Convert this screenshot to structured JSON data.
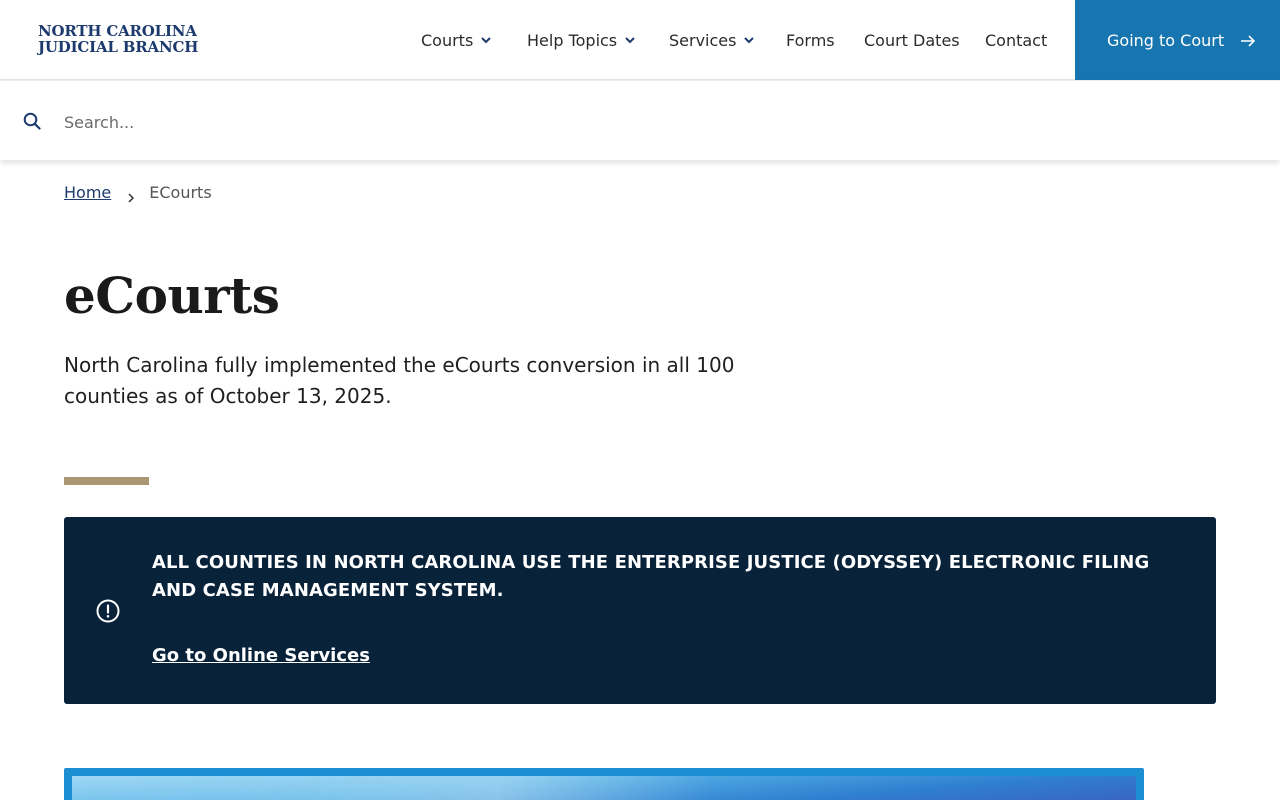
{
  "header": {
    "logo_line1": "NORTH CAROLINA",
    "logo_line2": "JUDICIAL BRANCH",
    "nav": [
      {
        "label": "Courts",
        "has_dropdown": true
      },
      {
        "label": "Help Topics",
        "has_dropdown": true
      },
      {
        "label": "Services",
        "has_dropdown": true
      },
      {
        "label": "Forms",
        "has_dropdown": false
      },
      {
        "label": "Court Dates",
        "has_dropdown": false
      },
      {
        "label": "Contact",
        "has_dropdown": false
      }
    ],
    "cta_label": "Going to Court"
  },
  "search": {
    "placeholder": "Search...",
    "icon": "search-icon"
  },
  "breadcrumb": {
    "home": "Home",
    "current": "ECourts"
  },
  "main": {
    "title": "eCourts",
    "intro": "North Carolina fully implemented the eCourts conversion in all 100 counties as of October 13, 2025.",
    "alert": {
      "icon": "exclamation-circle-icon",
      "text": "All counties in North Carolina use the Enterprise Justice (Odyssey) electronic filing and case management system.",
      "link": "Go to Online Services"
    }
  },
  "colors": {
    "brand_navy": "#1d3a6e",
    "cta_blue": "#1776b0",
    "alert_bg": "#08223a",
    "accent_gold": "#a89770"
  }
}
